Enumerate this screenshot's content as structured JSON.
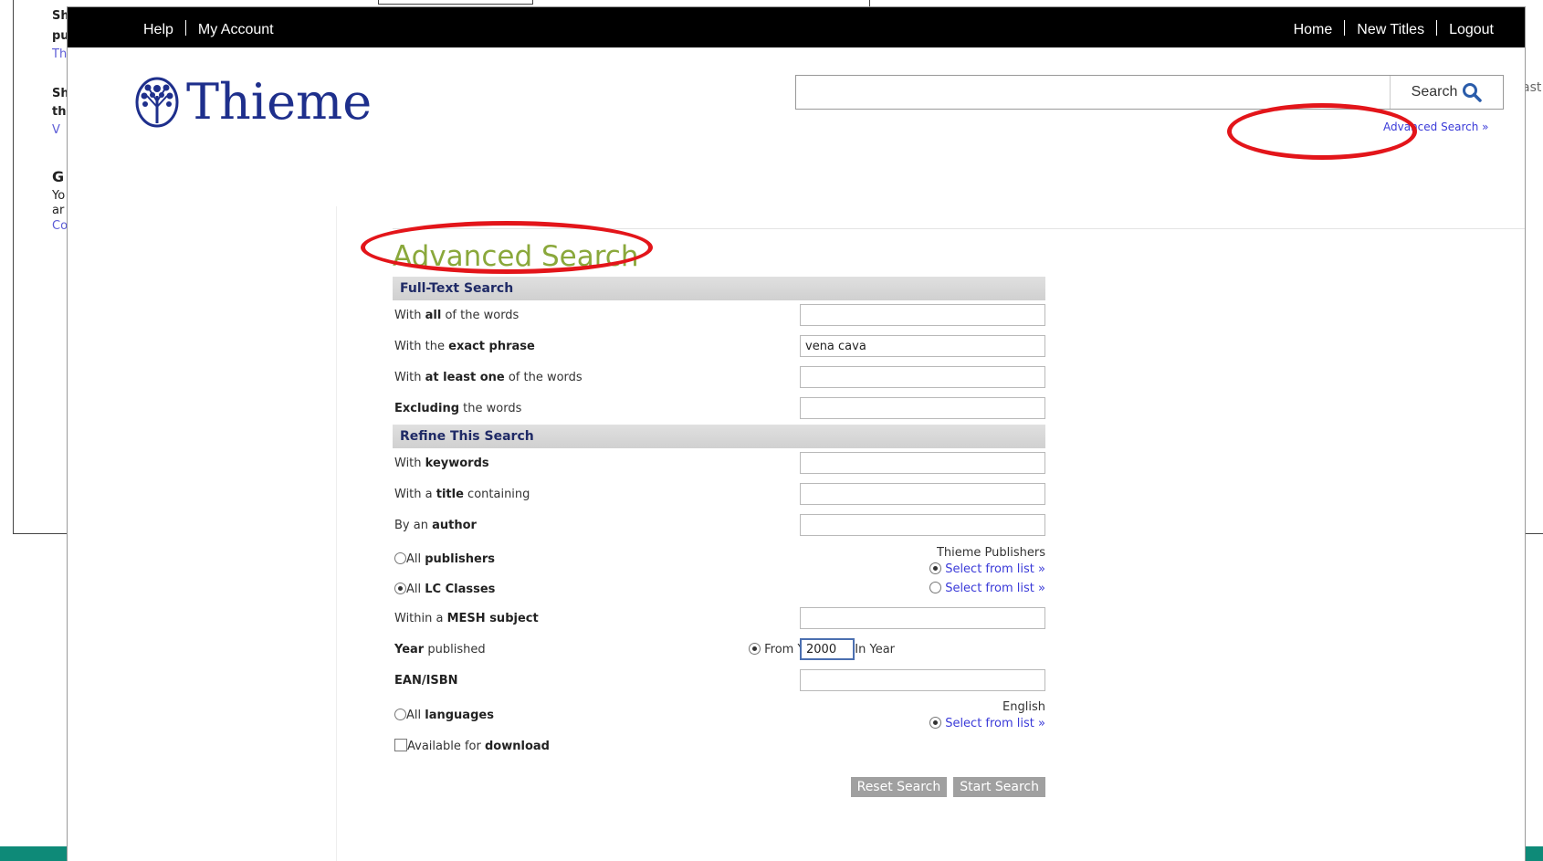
{
  "background": {
    "lines": [
      "Sh",
      "pu",
      "Th",
      "Sh",
      "th",
      "V",
      "G",
      "Yo",
      "ar",
      "Co"
    ],
    "right_fragment": "ast"
  },
  "topbar": {
    "left_links": [
      "Help",
      "My Account"
    ],
    "right_links": [
      "Home",
      "New Titles",
      "Logout"
    ]
  },
  "logo": {
    "text": "Thieme",
    "color": "#1e2f8c"
  },
  "search": {
    "value": "",
    "button_label": "Search",
    "advanced_link": "Advanced Search »"
  },
  "page": {
    "title": "Advanced Search",
    "title_color": "#8aa83b",
    "highlight_color": "#e3151a"
  },
  "form": {
    "full_text_header": "Full-Text Search",
    "all_words": {
      "pre": "With ",
      "bold": "all",
      "post": " of the words",
      "value": ""
    },
    "exact_phrase": {
      "pre": "With the ",
      "bold": "exact phrase",
      "post": "",
      "value": "vena cava"
    },
    "at_least_one": {
      "pre": "With ",
      "bold": "at least one",
      "post": " of the words",
      "value": ""
    },
    "excluding": {
      "pre": "",
      "bold": "Excluding",
      "post": " the words",
      "value": ""
    },
    "refine_header": "Refine This Search",
    "keywords": {
      "pre": "With ",
      "bold": "keywords",
      "post": "",
      "value": ""
    },
    "title": {
      "pre": "With a ",
      "bold": "title",
      "post": " containing",
      "value": ""
    },
    "author": {
      "pre": "By an ",
      "bold": "author",
      "post": "",
      "value": ""
    },
    "publishers": {
      "pre": "All ",
      "bold": "publishers",
      "selected_text": "Thieme Publishers",
      "select_link": "Select from list »",
      "all_checked": false,
      "list_checked": true
    },
    "lc_classes": {
      "pre": "All ",
      "bold": "LC Classes",
      "select_link": "Select from list »",
      "all_checked": true,
      "list_checked": false
    },
    "mesh": {
      "pre": "Within a ",
      "bold": "MESH subject",
      "post": "",
      "value": ""
    },
    "year": {
      "bold": "Year",
      "post": " published",
      "from_label": "From Year",
      "in_label": "In Year",
      "from_checked": true,
      "in_checked": false,
      "value": "2000"
    },
    "isbn": {
      "bold": "EAN/ISBN",
      "value": ""
    },
    "languages": {
      "pre": "All ",
      "bold": "languages",
      "selected_text": "English",
      "select_link": "Select from list »",
      "all_checked": false,
      "list_checked": true
    },
    "download": {
      "pre": "Available for ",
      "bold": "download",
      "checked": false
    },
    "reset_label": "Reset Search",
    "start_label": "Start Search"
  }
}
